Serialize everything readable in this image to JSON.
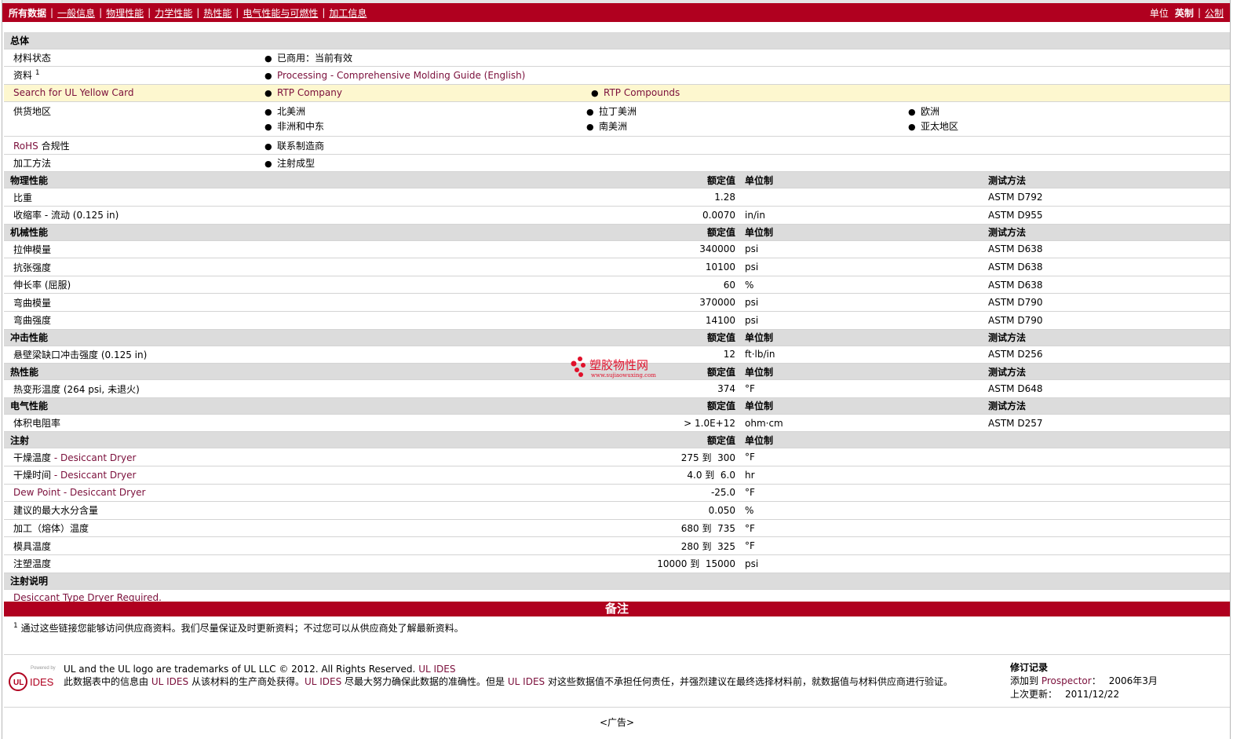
{
  "nav": {
    "items": [
      "所有数据",
      "一般信息",
      "物理性能",
      "力学性能",
      "热性能",
      "电气性能与可燃性",
      "加工信息"
    ],
    "units_label": "单位",
    "imperial": "英制",
    "metric": "公制"
  },
  "general": {
    "title": "总体",
    "status_label": "材料状态",
    "status_value": "已商用：当前有效",
    "info_label": "资料",
    "info_sup": "1",
    "info_link": "Processing - Comprehensive Molding Guide (English)",
    "yellowcard_label": "Search for UL Yellow Card",
    "yellowcard_links": [
      "RTP Company",
      "RTP Compounds"
    ],
    "region_label": "供货地区",
    "regions": [
      "北美洲",
      "拉丁美洲",
      "欧洲",
      "非洲和中东",
      "南美洲",
      "亚太地区"
    ],
    "rohs_label_link": "RoHS",
    "rohs_label": "合规性",
    "rohs_value": "联系制造商",
    "method_label": "加工方法",
    "method_value": "注射成型"
  },
  "headers": {
    "value": "额定值",
    "unit": "单位制",
    "test": "测试方法"
  },
  "sections": [
    {
      "title": "物理性能",
      "show_test": true,
      "rows": [
        {
          "label": "比重",
          "sub": "",
          "value": "1.28",
          "unit": "",
          "test": "ASTM D792"
        },
        {
          "label": "收缩率",
          "sub": " - 流动 (0.125 in)",
          "value": "0.0070",
          "unit": "in/in",
          "test": "ASTM D955"
        }
      ]
    },
    {
      "title": "机械性能",
      "show_test": true,
      "rows": [
        {
          "label": "拉伸模量",
          "sub": "",
          "value": "340000",
          "unit": "psi",
          "test": "ASTM D638"
        },
        {
          "label": "抗张强度",
          "sub": "",
          "value": "10100",
          "unit": "psi",
          "test": "ASTM D638"
        },
        {
          "label": "伸长率",
          "sub": " (屈服)",
          "value": "60",
          "unit": "%",
          "test": "ASTM D638"
        },
        {
          "label": "弯曲模量",
          "sub": "",
          "value": "370000",
          "unit": "psi",
          "test": "ASTM D790"
        },
        {
          "label": "弯曲强度",
          "sub": "",
          "value": "14100",
          "unit": "psi",
          "test": "ASTM D790"
        }
      ]
    },
    {
      "title": "冲击性能",
      "show_test": true,
      "rows": [
        {
          "label": "悬壁梁缺口冲击强度",
          "sub": " (0.125 in)",
          "value": "12",
          "unit": "ft·lb/in",
          "test": "ASTM D256"
        }
      ]
    },
    {
      "title": "热性能",
      "show_test": true,
      "rows": [
        {
          "label": "热变形温度",
          "sub": " (264 psi, 未退火)",
          "value": "374",
          "unit": "°F",
          "test": "ASTM D648"
        }
      ]
    },
    {
      "title": "电气性能",
      "show_test": true,
      "rows": [
        {
          "label": "体积电阻率",
          "sub": "",
          "value": "> 1.0E+12",
          "unit": "ohm·cm",
          "test": "ASTM D257"
        }
      ]
    },
    {
      "title": "注射",
      "show_test": false,
      "rows": [
        {
          "label": "干燥温度",
          "sub": " - Desiccant Dryer",
          "value": "275 到  300",
          "unit": "°F",
          "test": ""
        },
        {
          "label": "干燥时间",
          "sub": " - Desiccant Dryer",
          "value": "4.0 到  6.0",
          "unit": "hr",
          "test": ""
        },
        {
          "label": "Dew Point - Desiccant Dryer",
          "sub": "",
          "value": "-25.0",
          "unit": "°F",
          "test": ""
        },
        {
          "label": "建议的最大水分含量",
          "sub": "",
          "value": "0.050",
          "unit": "%",
          "test": ""
        },
        {
          "label": "加工（熔体）温度",
          "sub": "",
          "value": "680 到  735",
          "unit": "°F",
          "test": ""
        },
        {
          "label": "模具温度",
          "sub": "",
          "value": "280 到  325",
          "unit": "°F",
          "test": ""
        },
        {
          "label": "注塑温度",
          "sub": "",
          "value": "10000 到  15000",
          "unit": "psi",
          "test": ""
        }
      ]
    }
  ],
  "inj_notes": {
    "title": "注射说明",
    "text": "Desiccant Type Dryer Required."
  },
  "notes": {
    "title": "备注",
    "sup": "1",
    "text": "通过这些链接您能够访问供应商资料。我们尽量保证及时更新资料；不过您可以从供应商处了解最新资料。"
  },
  "footer": {
    "logo_small": "Powered by",
    "logo_ul": "UL",
    "logo_ides": "IDES",
    "line1": "UL and the UL logo are trademarks of UL LLC © 2012. All Rights Reserved.",
    "line1_link": "UL IDES",
    "line2a": "此数据表中的信息由",
    "line2_link1": "UL IDES",
    "line2b": "从该材料的生产商处获得。",
    "line2_link2": "UL IDES",
    "line2c": "尽最大努力确保此数据的准确性。但是",
    "line2_link3": "UL IDES",
    "line2d": "对这些数据值不承担任何责任，并强烈建议在最终选择材料前，就数据值与材料供应商进行验证。",
    "rev_title": "修订记录",
    "added_label": "添加到",
    "added_link": "Prospector",
    "added_sep": "：",
    "added_value": "2006年3月",
    "updated_label": "上次更新：",
    "updated_value": "2011/12/22"
  },
  "ad": "<广告>",
  "watermark": {
    "text": "塑胶物性网",
    "url": "www.sujiaowuxing.com"
  },
  "colors": {
    "brand": "#b0001f",
    "link": "#7b0f3b",
    "section_bg": "#dcdcdc",
    "highlight": "#fdf7cf"
  }
}
